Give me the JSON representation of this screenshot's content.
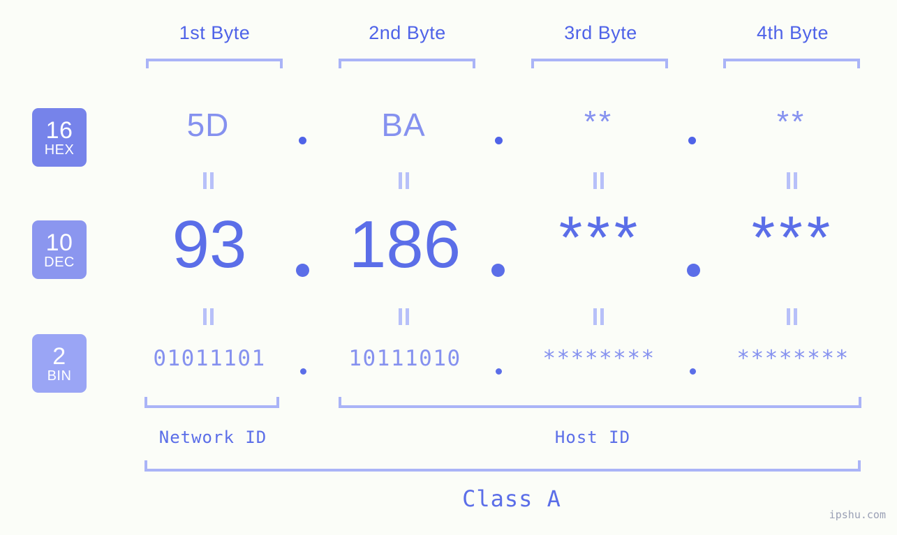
{
  "theme": {
    "background": "#fbfdf8",
    "accent_strong": "#4f63e8",
    "accent_mid": "#5b6ee8",
    "accent_light": "#8591ef",
    "accent_bracket": "#aab4f7",
    "badge_hex_bg": "#7683ea",
    "badge_dec_bg": "#8b96ef",
    "badge_bin_bg": "#9aa5f5",
    "watermark_color": "#9aa0b5"
  },
  "byte_headers": [
    {
      "label": "1st Byte"
    },
    {
      "label": "2nd Byte"
    },
    {
      "label": "3rd Byte"
    },
    {
      "label": "4th Byte"
    }
  ],
  "bases": [
    {
      "number": "16",
      "name": "HEX"
    },
    {
      "number": "10",
      "name": "DEC"
    },
    {
      "number": "2",
      "name": "BIN"
    }
  ],
  "rows": {
    "hex": {
      "base_number": "16",
      "base_name": "HEX",
      "values": [
        "5D",
        "BA",
        "**",
        "**"
      ],
      "separator": "."
    },
    "dec": {
      "base_number": "10",
      "base_name": "DEC",
      "values": [
        "93",
        "186",
        "***",
        "***"
      ],
      "separator": "."
    },
    "bin": {
      "base_number": "2",
      "base_name": "BIN",
      "values": [
        "01011101",
        "10111010",
        "********",
        "********"
      ],
      "separator": "."
    }
  },
  "equality_marker": "=",
  "segments": {
    "network_id": "Network ID",
    "host_id": "Host ID",
    "class": "Class A"
  },
  "watermark": "ipshu.com"
}
